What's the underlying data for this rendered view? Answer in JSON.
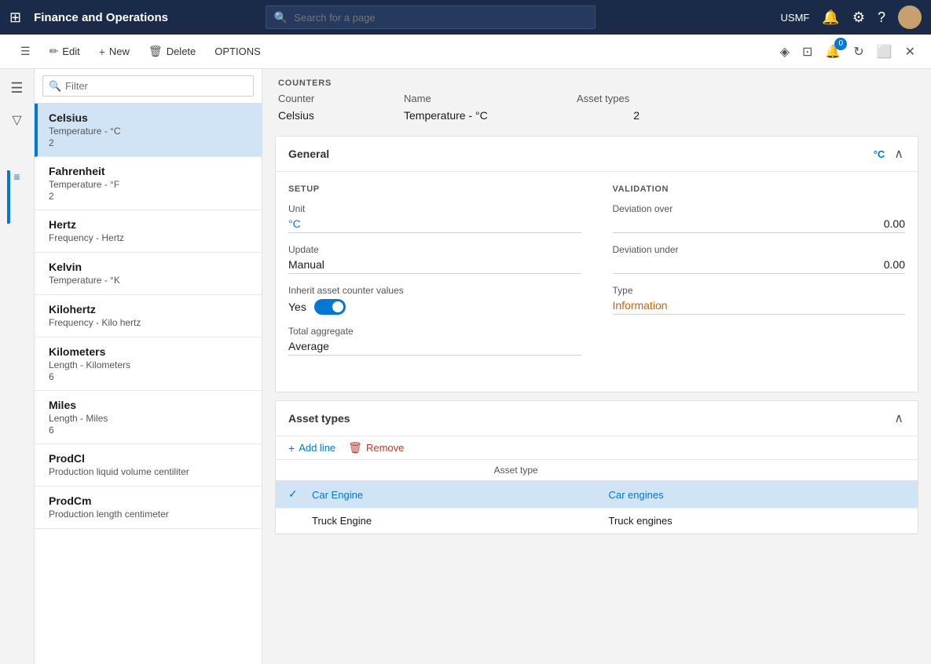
{
  "app": {
    "title": "Finance and Operations",
    "search_placeholder": "Search for a page",
    "tenant": "USMF"
  },
  "toolbar": {
    "edit_label": "Edit",
    "new_label": "New",
    "delete_label": "Delete",
    "options_label": "OPTIONS"
  },
  "filter": {
    "placeholder": "Filter"
  },
  "list": [
    {
      "id": "celsius",
      "name": "Celsius",
      "sub": "Temperature - °C",
      "count": "2",
      "selected": true
    },
    {
      "id": "fahrenheit",
      "name": "Fahrenheit",
      "sub": "Temperature - °F",
      "count": "2",
      "selected": false
    },
    {
      "id": "hertz",
      "name": "Hertz",
      "sub": "Frequency - Hertz",
      "count": "",
      "selected": false
    },
    {
      "id": "kelvin",
      "name": "Kelvin",
      "sub": "Temperature - °K",
      "count": "",
      "selected": false
    },
    {
      "id": "kilohertz",
      "name": "Kilohertz",
      "sub": "Frequency - Kilo hertz",
      "count": "",
      "selected": false
    },
    {
      "id": "kilometers",
      "name": "Kilometers",
      "sub": "Length - Kilometers",
      "count": "6",
      "selected": false
    },
    {
      "id": "miles",
      "name": "Miles",
      "sub": "Length - Miles",
      "count": "6",
      "selected": false
    },
    {
      "id": "prodcl",
      "name": "ProdCl",
      "sub": "Production liquid volume centiliter",
      "count": "",
      "selected": false
    },
    {
      "id": "prodcm",
      "name": "ProdCm",
      "sub": "Production length centimeter",
      "count": "",
      "selected": false
    }
  ],
  "counters": {
    "section_label": "COUNTERS",
    "col_counter": "Counter",
    "col_name": "Name",
    "col_asset_types": "Asset types",
    "val_counter": "Celsius",
    "val_name": "Temperature - °C",
    "val_asset_types": "2"
  },
  "general": {
    "title": "General",
    "indicator": "°C",
    "setup_label": "SETUP",
    "validation_label": "VALIDATION",
    "unit_label": "Unit",
    "unit_value": "°C",
    "deviation_over_label": "Deviation over",
    "deviation_over_value": "0.00",
    "update_label": "Update",
    "update_value": "Manual",
    "deviation_under_label": "Deviation under",
    "deviation_under_value": "0.00",
    "inherit_label": "Inherit asset counter values",
    "inherit_toggle_yes": "Yes",
    "type_label": "Type",
    "type_value": "Information",
    "total_aggregate_label": "Total aggregate",
    "total_aggregate_value": "Average"
  },
  "asset_types": {
    "title": "Asset types",
    "add_line_label": "Add line",
    "remove_label": "Remove",
    "col_asset_type": "Asset type",
    "rows": [
      {
        "id": "car-engine",
        "col1": "Car Engine",
        "col2": "Car engines",
        "selected": true
      },
      {
        "id": "truck-engine",
        "col1": "Truck Engine",
        "col2": "Truck engines",
        "selected": false
      }
    ]
  },
  "icons": {
    "grid": "⊞",
    "search": "🔍",
    "bell": "🔔",
    "gear": "⚙",
    "question": "?",
    "edit": "✏",
    "new_plus": "+",
    "delete": "🗑",
    "filter": "≡",
    "collapse_arrow": "∧",
    "expand_arrow": "∨",
    "add_line": "+",
    "remove": "🗑",
    "close": "✕",
    "refresh": "↻",
    "window": "⬜",
    "pin": "◈",
    "office": "⊡",
    "notif_count": "0",
    "check": "✓",
    "sidebar_menu": "☰"
  }
}
